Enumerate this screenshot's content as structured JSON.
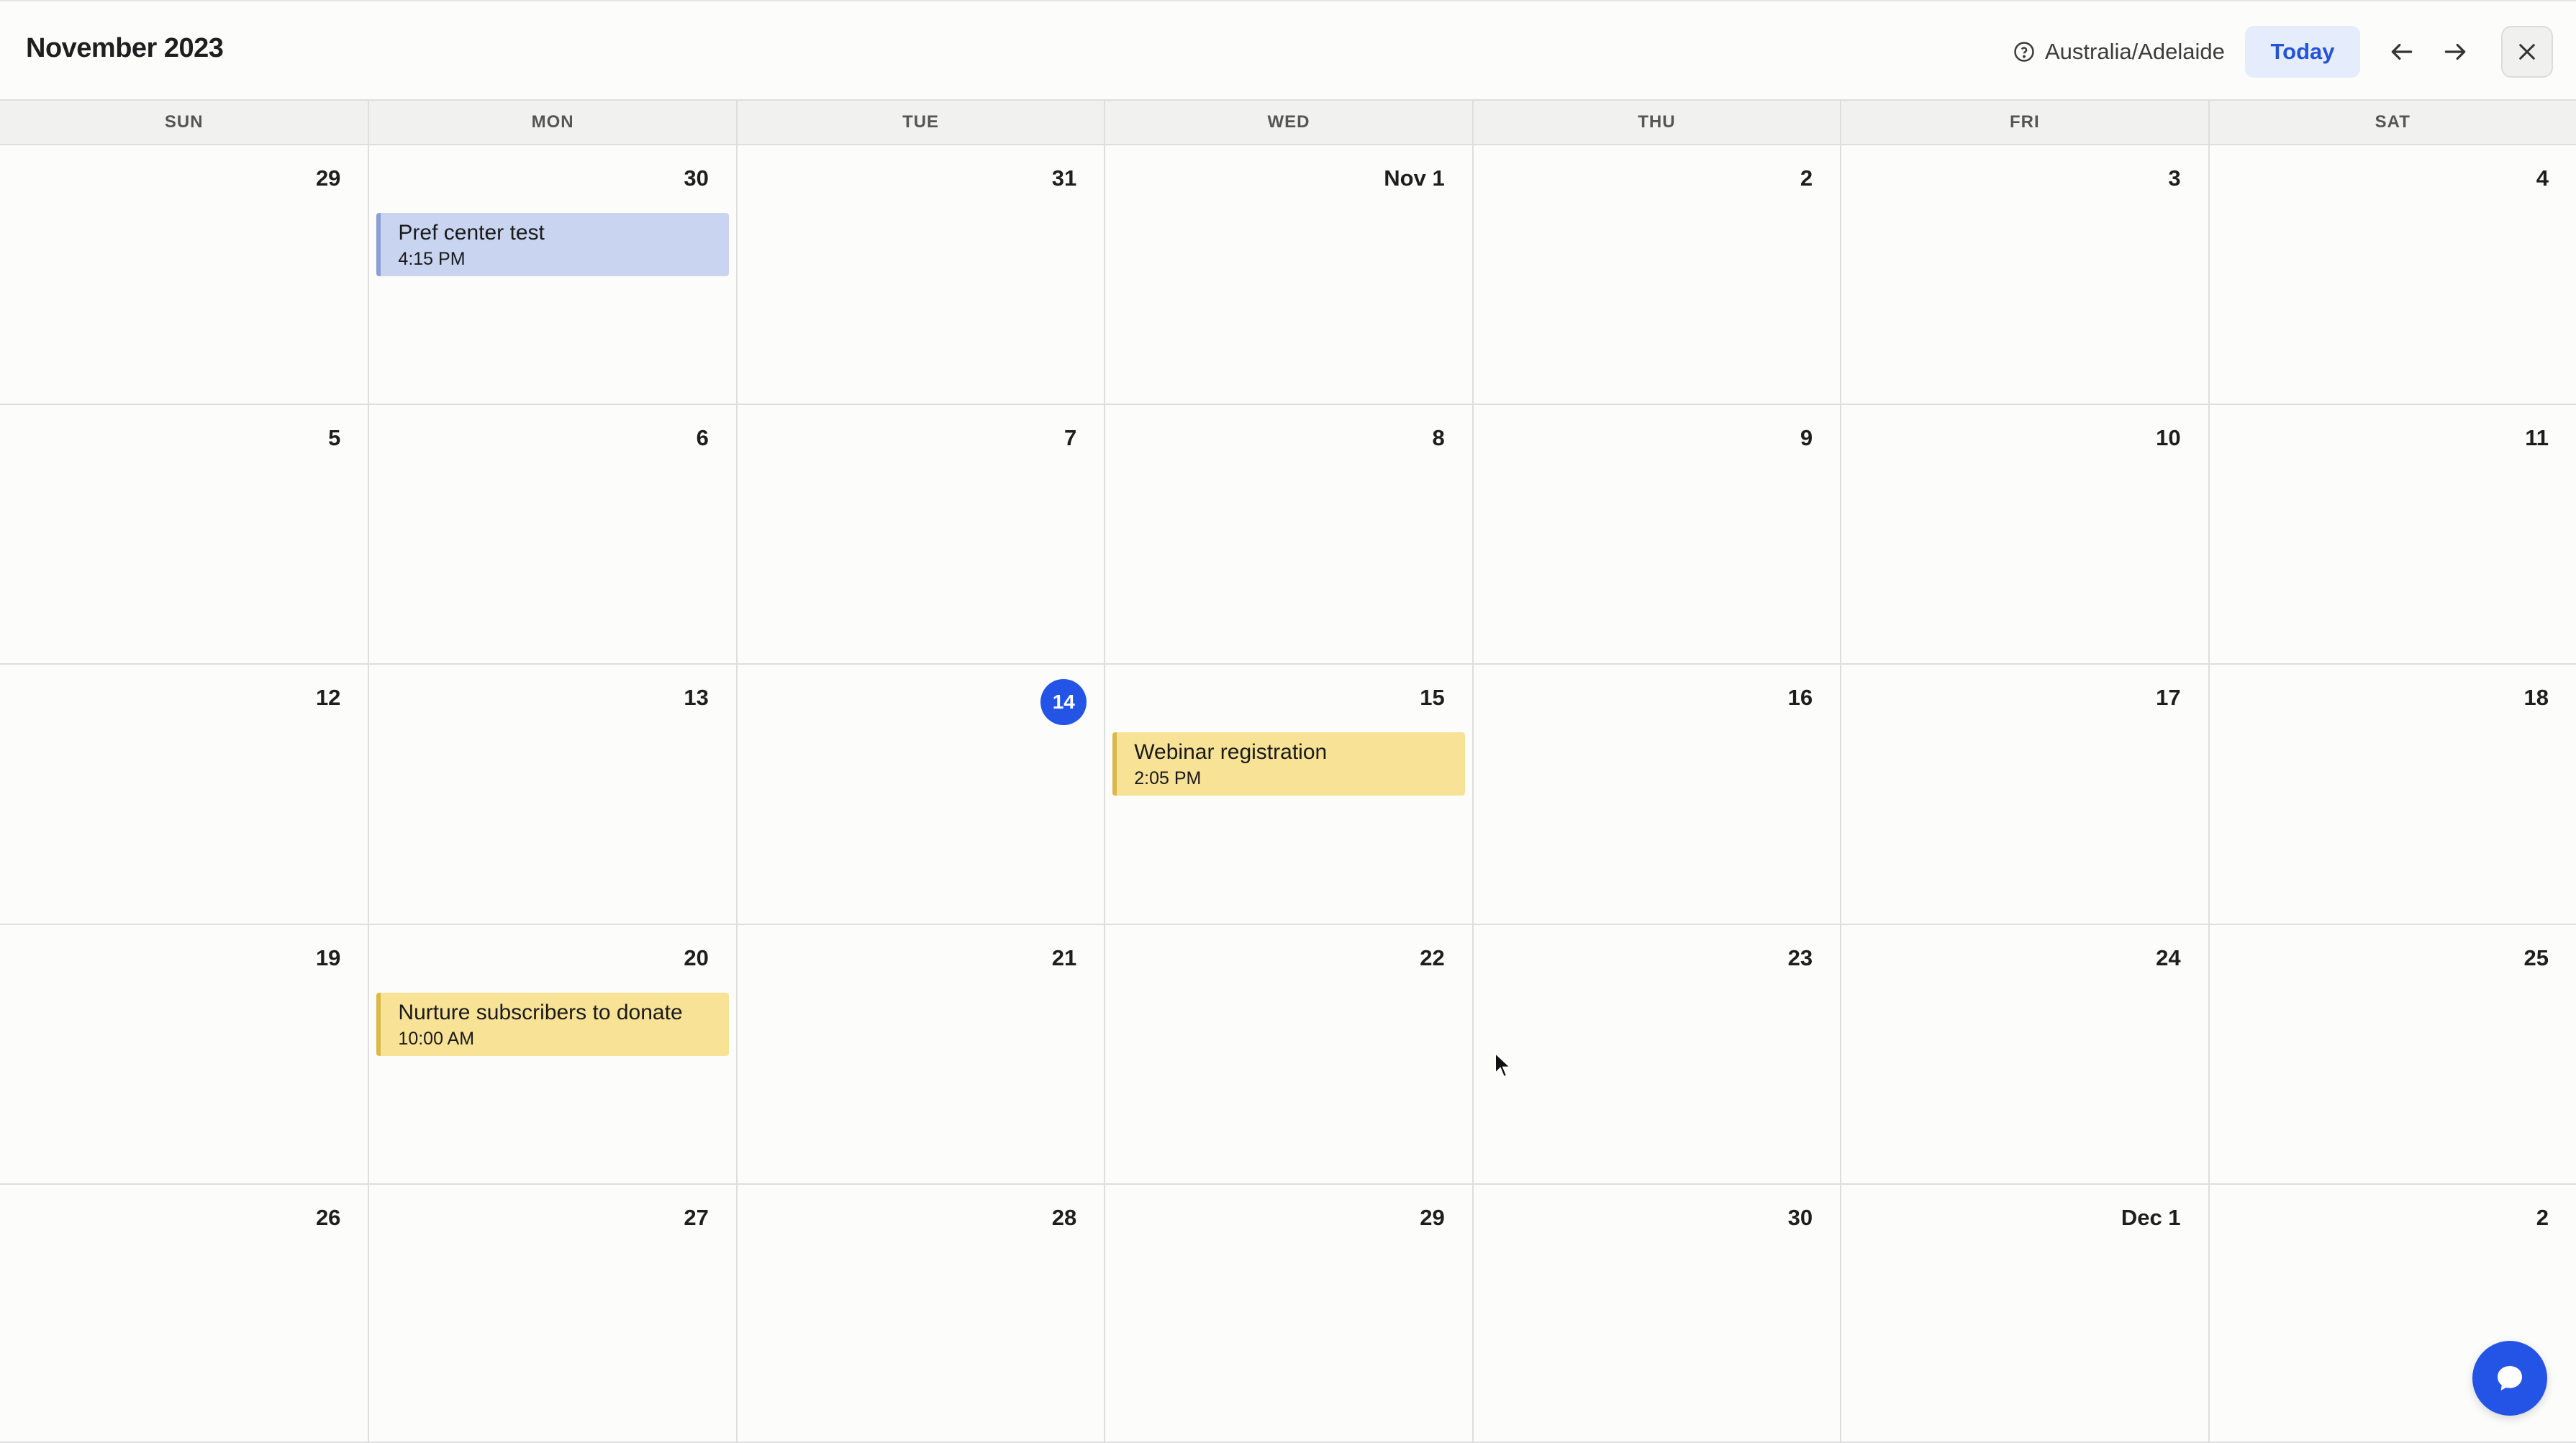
{
  "header": {
    "title": "November 2023",
    "timezone": "Australia/Adelaide",
    "today_label": "Today"
  },
  "weekdays": [
    "SUN",
    "MON",
    "TUE",
    "WED",
    "THU",
    "FRI",
    "SAT"
  ],
  "weeks": [
    [
      "29",
      "30",
      "31",
      "Nov 1",
      "2",
      "3",
      "4"
    ],
    [
      "5",
      "6",
      "7",
      "8",
      "9",
      "10",
      "11"
    ],
    [
      "12",
      "13",
      "14",
      "15",
      "16",
      "17",
      "18"
    ],
    [
      "19",
      "20",
      "21",
      "22",
      "23",
      "24",
      "25"
    ],
    [
      "26",
      "27",
      "28",
      "29",
      "30",
      "Dec 1",
      "2"
    ]
  ],
  "today": "14",
  "events": [
    {
      "title": "Pref center test",
      "time": "4:15 PM",
      "color": "#c8d4f0"
    },
    {
      "title": "Webinar registration",
      "time": "2:05 PM",
      "color": "#f7e295"
    },
    {
      "title": "Nurture subscribers to donate",
      "time": "10:00 AM",
      "color": "#f7e295"
    }
  ],
  "colors": {
    "accent": "#2454e6",
    "today_button_bg": "#e5ecfb",
    "today_button_text": "#2453d8"
  },
  "icons": {
    "timezone": "question-circle-icon",
    "prev": "arrow-left-icon",
    "next": "arrow-right-icon",
    "close": "close-icon",
    "chat": "chat-bubble-icon"
  }
}
